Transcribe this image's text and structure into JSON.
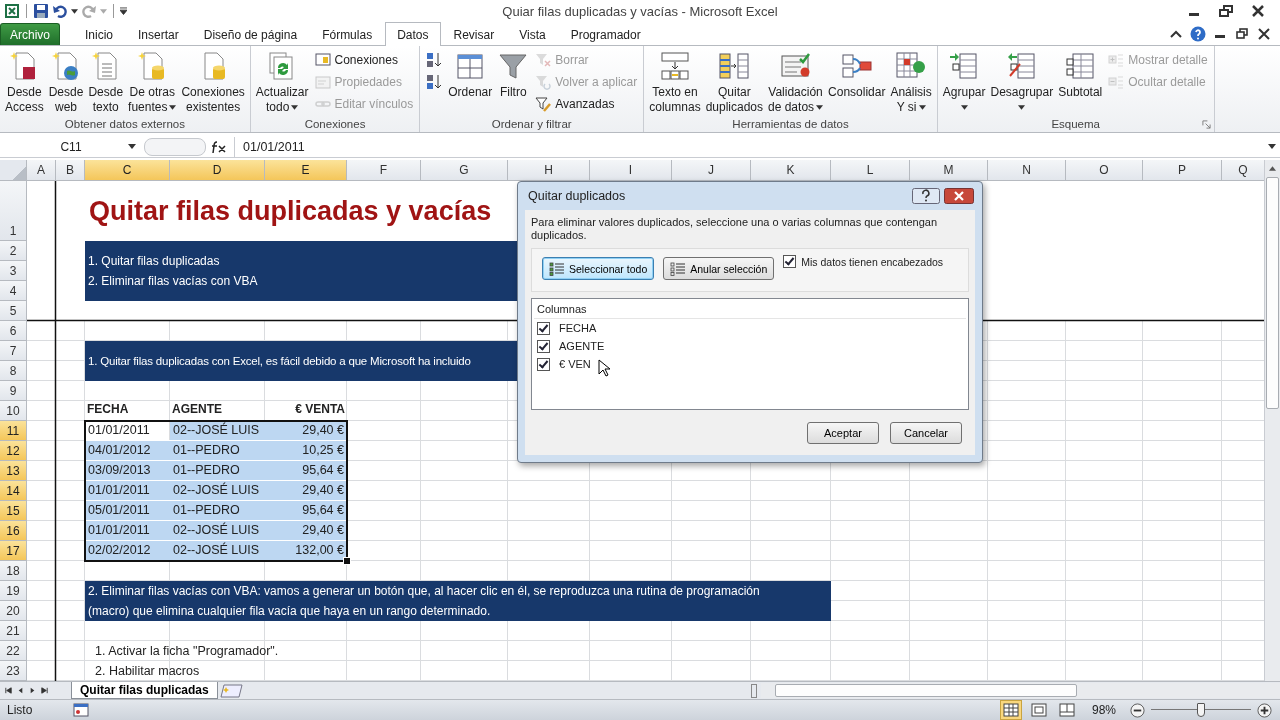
{
  "window": {
    "title": "Quiar filas duplicadas y vacías  -  Microsoft Excel"
  },
  "tabs": [
    {
      "label": "Archivo",
      "kind": "file",
      "selected": false
    },
    {
      "label": "Inicio",
      "kind": "tab",
      "selected": false
    },
    {
      "label": "Insertar",
      "kind": "tab",
      "selected": false
    },
    {
      "label": "Diseño de página",
      "kind": "tab",
      "selected": false
    },
    {
      "label": "Fórmulas",
      "kind": "tab",
      "selected": false
    },
    {
      "label": "Datos",
      "kind": "tab",
      "selected": true
    },
    {
      "label": "Revisar",
      "kind": "tab",
      "selected": false
    },
    {
      "label": "Vista",
      "kind": "tab",
      "selected": false
    },
    {
      "label": "Programador",
      "kind": "tab",
      "selected": false
    }
  ],
  "ribbon": {
    "groups": [
      {
        "label": "Obtener datos externos",
        "launcher": false,
        "items": [
          {
            "kind": "large",
            "lines": [
              "Desde",
              "Access"
            ],
            "dropdown": false
          },
          {
            "kind": "large",
            "lines": [
              "Desde",
              "web"
            ],
            "dropdown": false
          },
          {
            "kind": "large",
            "lines": [
              "Desde",
              "texto"
            ],
            "dropdown": false
          },
          {
            "kind": "large",
            "lines": [
              "De otras",
              "fuentes"
            ],
            "dropdown": true
          },
          {
            "kind": "large",
            "lines": [
              "Conexiones",
              "existentes"
            ],
            "dropdown": false
          }
        ]
      },
      {
        "label": "Conexiones",
        "launcher": false,
        "items": [
          {
            "kind": "large",
            "lines": [
              "Actualizar",
              "todo"
            ],
            "dropdown": true
          },
          {
            "kind": "stack",
            "items": [
              {
                "label": "Conexiones",
                "disabled": false
              },
              {
                "label": "Propiedades",
                "disabled": true
              },
              {
                "label": "Editar vínculos",
                "disabled": true
              }
            ]
          }
        ]
      },
      {
        "label": "Ordenar y filtrar",
        "launcher": false,
        "items": [
          {
            "kind": "stack",
            "items": [
              {
                "disabled": false
              },
              {
                "disabled": false
              }
            ]
          },
          {
            "kind": "large",
            "lines": [
              "Ordenar"
            ],
            "dropdown": false
          },
          {
            "kind": "large",
            "lines": [
              "Filtro"
            ],
            "dropdown": false
          },
          {
            "kind": "stack",
            "items": [
              {
                "label": "Borrar",
                "disabled": true
              },
              {
                "label": "Volver a aplicar",
                "disabled": true
              },
              {
                "label": "Avanzadas",
                "disabled": false
              }
            ]
          }
        ]
      },
      {
        "label": "Herramientas de datos",
        "launcher": false,
        "items": [
          {
            "kind": "large",
            "lines": [
              "Texto en",
              "columnas"
            ],
            "dropdown": false
          },
          {
            "kind": "large",
            "lines": [
              "Quitar",
              "duplicados"
            ],
            "dropdown": false
          },
          {
            "kind": "large",
            "lines": [
              "Validación",
              "de datos"
            ],
            "dropdown": true
          },
          {
            "kind": "large",
            "lines": [
              "Consolidar"
            ],
            "dropdown": false
          },
          {
            "kind": "large",
            "lines": [
              "Análisis",
              "Y si"
            ],
            "dropdown": true
          }
        ]
      },
      {
        "label": "Esquema",
        "launcher": true,
        "items": [
          {
            "kind": "large",
            "lines": [
              "Agrupar"
            ],
            "dropdown": true
          },
          {
            "kind": "large",
            "lines": [
              "Desagrupar"
            ],
            "dropdown": true
          },
          {
            "kind": "large",
            "lines": [
              "Subtotal"
            ],
            "dropdown": false
          },
          {
            "kind": "stack",
            "items": [
              {
                "label": "Mostrar detalle",
                "disabled": true
              },
              {
                "label": "Ocultar detalle",
                "disabled": true
              }
            ]
          }
        ]
      }
    ]
  },
  "formula_bar": {
    "name_box": "C11",
    "value": "01/01/2011"
  },
  "sheet": {
    "columns": [
      {
        "label": "A",
        "selected": false
      },
      {
        "label": "B",
        "selected": false
      },
      {
        "label": "C",
        "selected": true
      },
      {
        "label": "D",
        "selected": true
      },
      {
        "label": "E",
        "selected": true
      },
      {
        "label": "F",
        "selected": false
      },
      {
        "label": "G",
        "selected": false
      },
      {
        "label": "H",
        "selected": false
      },
      {
        "label": "I",
        "selected": false
      },
      {
        "label": "J",
        "selected": false
      },
      {
        "label": "K",
        "selected": false
      },
      {
        "label": "L",
        "selected": false
      },
      {
        "label": "M",
        "selected": false
      },
      {
        "label": "N",
        "selected": false
      },
      {
        "label": "O",
        "selected": false
      },
      {
        "label": "P",
        "selected": false
      },
      {
        "label": "Q",
        "selected": false
      }
    ],
    "rows": [
      {
        "label": "1",
        "selected": false
      },
      {
        "label": "2",
        "selected": false
      },
      {
        "label": "3",
        "selected": false
      },
      {
        "label": "4",
        "selected": false
      },
      {
        "label": "5",
        "selected": false
      },
      {
        "label": "6",
        "selected": false
      },
      {
        "label": "7",
        "selected": false
      },
      {
        "label": "8",
        "selected": false
      },
      {
        "label": "9",
        "selected": false
      },
      {
        "label": "10",
        "selected": false
      },
      {
        "label": "11",
        "selected": true
      },
      {
        "label": "12",
        "selected": true
      },
      {
        "label": "13",
        "selected": true
      },
      {
        "label": "14",
        "selected": true
      },
      {
        "label": "15",
        "selected": true
      },
      {
        "label": "16",
        "selected": true
      },
      {
        "label": "17",
        "selected": true
      },
      {
        "label": "18",
        "selected": false
      },
      {
        "label": "19",
        "selected": false
      },
      {
        "label": "20",
        "selected": false
      },
      {
        "label": "21",
        "selected": false
      },
      {
        "label": "22",
        "selected": false
      },
      {
        "label": "23",
        "selected": false
      }
    ],
    "title": "Quitar filas duplicadas y vacías",
    "bands": [
      {
        "lines": [
          "1. Quitar filas duplicadas",
          "2. Eliminar filas vacías con VBA"
        ]
      },
      {
        "lines": [
          "1. Quitar filas duplicadas con Excel, es fácil debido a que Microsoft ha incluido"
        ]
      },
      {
        "lines": [
          "2. Eliminar filas vacías con VBA: vamos a generar un botón que, al hacer clic en él, se reproduzca una rutina de programación",
          "(macro) que elimina cualquier fila vacía que haya en un rango determinado."
        ]
      }
    ],
    "table": {
      "headers": [
        "FECHA",
        "AGENTE",
        "€ VENTA"
      ],
      "rows": [
        {
          "selected": true,
          "cells": [
            {
              "text": "01/01/2011",
              "active": true
            },
            {
              "text": "02--JOSÉ LUIS",
              "active": false
            },
            {
              "text": "29,40 €",
              "active": false
            }
          ]
        },
        {
          "selected": true,
          "cells": [
            {
              "text": "04/01/2012",
              "active": false
            },
            {
              "text": "01--PEDRO",
              "active": false
            },
            {
              "text": "10,25 €",
              "active": false
            }
          ]
        },
        {
          "selected": true,
          "cells": [
            {
              "text": "03/09/2013",
              "active": false
            },
            {
              "text": "01--PEDRO",
              "active": false
            },
            {
              "text": "95,64 €",
              "active": false
            }
          ]
        },
        {
          "selected": true,
          "cells": [
            {
              "text": "01/01/2011",
              "active": false
            },
            {
              "text": "02--JOSÉ LUIS",
              "active": false
            },
            {
              "text": "29,40 €",
              "active": false
            }
          ]
        },
        {
          "selected": true,
          "cells": [
            {
              "text": "05/01/2011",
              "active": false
            },
            {
              "text": "01--PEDRO",
              "active": false
            },
            {
              "text": "95,64 €",
              "active": false
            }
          ]
        },
        {
          "selected": true,
          "cells": [
            {
              "text": "01/01/2011",
              "active": false
            },
            {
              "text": "02--JOSÉ LUIS",
              "active": false
            },
            {
              "text": "29,40 €",
              "active": false
            }
          ]
        },
        {
          "selected": true,
          "cells": [
            {
              "text": "02/02/2012",
              "active": false
            },
            {
              "text": "02--JOSÉ LUIS",
              "active": false
            },
            {
              "text": "132,00 €",
              "active": false
            }
          ]
        }
      ]
    },
    "steps": [
      "1. Activar la ficha \"Programador\".",
      "2. Habilitar macros"
    ]
  },
  "dialog": {
    "title": "Quitar duplicados",
    "description": "Para eliminar valores duplicados, seleccione una o varias columnas que contengan duplicados.",
    "buttons": [
      {
        "label": "Seleccionar todo",
        "selected": true
      },
      {
        "label": "Anular selección",
        "selected": false
      }
    ],
    "headers_option": {
      "label": "Mis datos tienen encabezados",
      "checked": true
    },
    "list": {
      "header": "Columnas",
      "items": [
        {
          "label": "FECHA",
          "checked": true
        },
        {
          "label": "AGENTE",
          "checked": true
        },
        {
          "label": "€ VEN",
          "checked": true
        }
      ]
    },
    "actions": [
      "Aceptar",
      "Cancelar"
    ]
  },
  "sheet_tabs": [
    {
      "label": "Quitar filas duplicadas",
      "selected": true
    }
  ],
  "status_bar": {
    "text": "Listo",
    "views": [
      {
        "selected": true
      },
      {
        "selected": false
      },
      {
        "selected": false
      }
    ],
    "zoom": "98%",
    "zoom_level": {
      "level": 0.5
    }
  }
}
